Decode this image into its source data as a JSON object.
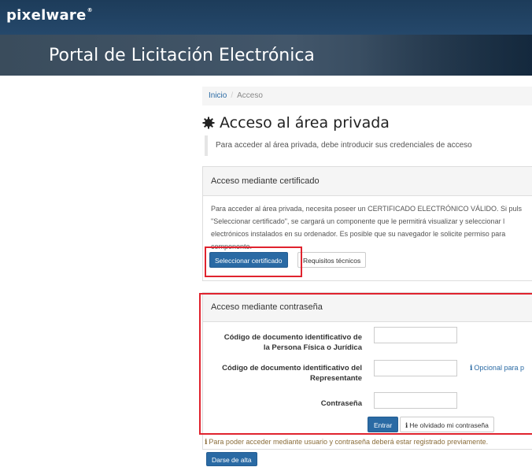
{
  "header": {
    "logo": "pixelware",
    "logo_mark": "®",
    "portal_title": "Portal de Licitación Electrónica"
  },
  "breadcrumb": {
    "home": "Inicio",
    "separator": "/",
    "current": "Acceso"
  },
  "page": {
    "title": "Acceso al área privada",
    "intro": "Para acceder al área privada, debe introducir sus credenciales de acceso"
  },
  "certificate_panel": {
    "heading": "Acceso mediante certificado",
    "lines": [
      "Para acceder al área privada, necesita poseer un CERTIFICADO ELECTRÓNICO VÁLIDO. Si puls",
      "\"Seleccionar certificado\", se cargará un componente que le permitirá visualizar y seleccionar l",
      "electrónicos instalados en su ordenador. Es posible que su navegador le solicite permiso para",
      "componente."
    ],
    "select_button": "Seleccionar certificado",
    "requirements_button": "Requisitos técnicos"
  },
  "password_panel": {
    "heading": "Acceso mediante contraseña",
    "field1_label_line1": "Código de documento identificativo de",
    "field1_label_line2": "la Persona Física o Jurídica",
    "field2_label_line1": "Código de documento identificativo del",
    "field2_label_line2": "Representante",
    "field2_hint": "Opcional para p",
    "password_label": "Contraseña",
    "enter_button": "Entrar",
    "forgot_button": "He olvidado mi contraseña",
    "info_glyph": "i"
  },
  "footer": {
    "warning": "Para poder acceder mediante usuario y contraseña deberá estar registrado previamente.",
    "signup_button": "Darse de alta"
  },
  "colors": {
    "primary": "#2a6aa4",
    "highlight": "#e0232e",
    "header_bg": "#1d3c5a"
  }
}
